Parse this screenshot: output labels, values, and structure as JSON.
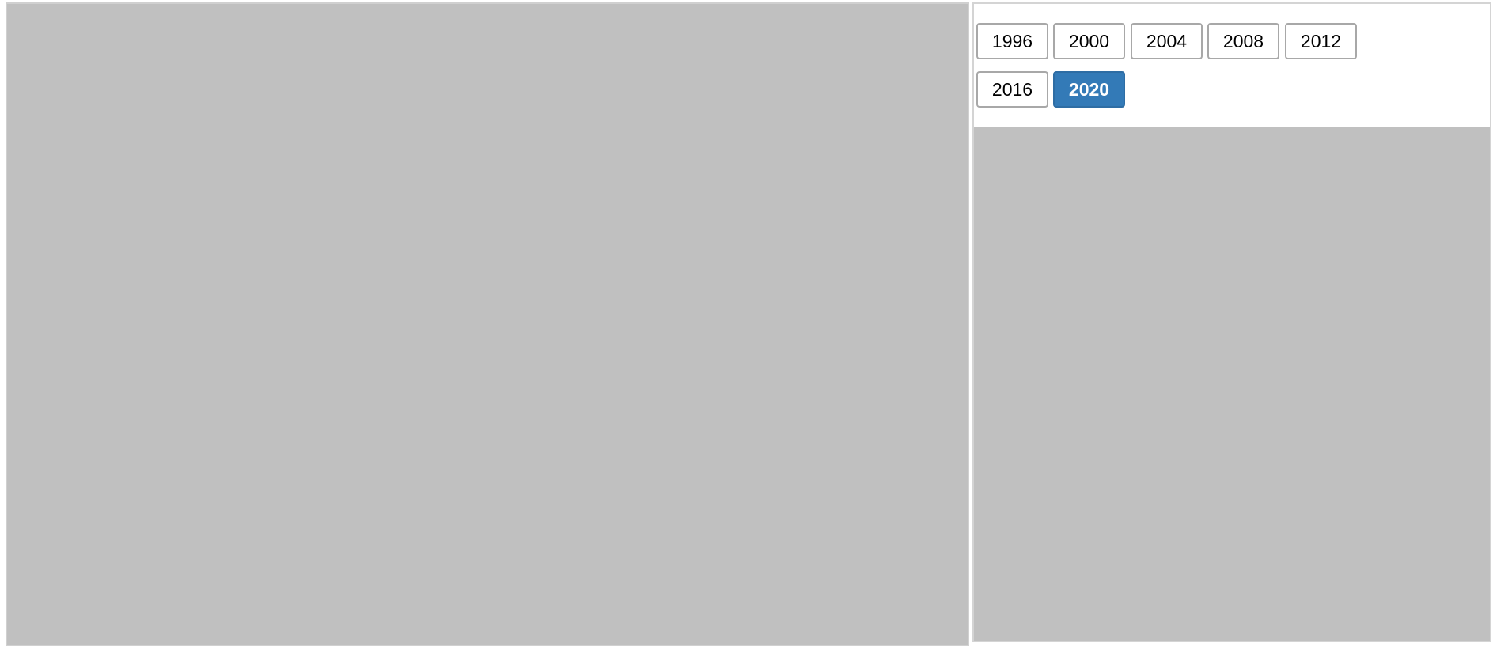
{
  "years": {
    "buttons": [
      {
        "label": "1996",
        "selected": false
      },
      {
        "label": "2000",
        "selected": false
      },
      {
        "label": "2004",
        "selected": false
      },
      {
        "label": "2008",
        "selected": false
      },
      {
        "label": "2012",
        "selected": false
      },
      {
        "label": "2016",
        "selected": false
      },
      {
        "label": "2020",
        "selected": true
      }
    ],
    "selected_color": "#337ab7"
  }
}
